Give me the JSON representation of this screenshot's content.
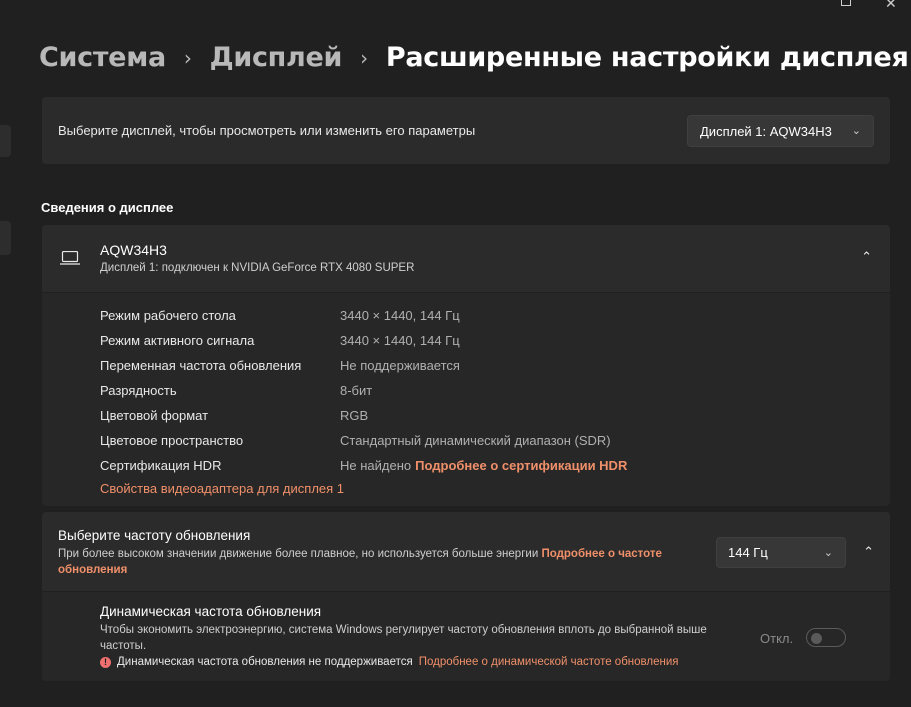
{
  "window": {
    "maximize_icon": "maximize-icon",
    "close_icon": "close-icon"
  },
  "breadcrumb": {
    "items": [
      "Система",
      "Дисплей"
    ],
    "current": "Расширенные настройки дисплея",
    "separator": "›"
  },
  "display_select": {
    "label": "Выберите дисплей, чтобы просмотреть или изменить его параметры",
    "selected": "Дисплей 1: AQW34H3"
  },
  "display_info": {
    "section_title": "Сведения о дисплее",
    "name": "AQW34H3",
    "subtitle": "Дисплей 1: подключен к NVIDIA GeForce RTX 4080 SUPER",
    "expanded": true,
    "rows": [
      {
        "key": "Режим рабочего стола",
        "value": "3440 × 1440, 144 Гц"
      },
      {
        "key": "Режим активного сигнала",
        "value": "3440 × 1440, 144 Гц"
      },
      {
        "key": "Переменная частота обновления",
        "value": "Не поддерживается"
      },
      {
        "key": "Разрядность",
        "value": "8-бит"
      },
      {
        "key": "Цветовой формат",
        "value": "RGB"
      },
      {
        "key": "Цветовое пространство",
        "value": "Стандартный динамический диапазон (SDR)"
      },
      {
        "key": "Сертификация HDR",
        "value": "Не найдено",
        "link": "Подробнее о сертификации HDR"
      }
    ],
    "adapter_link": "Свойства видеоадаптера для дисплея 1"
  },
  "refresh_rate": {
    "title": "Выберите частоту обновления",
    "description": "При более высоком значении движение более плавное, но используется больше энергии",
    "link": "Подробнее о частоте обновления",
    "selected": "144 Гц",
    "expanded": true
  },
  "dynamic_refresh": {
    "title": "Динамическая частота обновления",
    "description": "Чтобы экономить электроэнергию, система Windows регулирует частоту обновления вплоть до выбранной выше частоты.",
    "warning": "Динамическая частота обновления не поддерживается",
    "link": "Подробнее о динамической частоте обновления",
    "toggle_label": "Откл.",
    "toggle_on": false
  },
  "colors": {
    "accent_link": "#f0906a",
    "background": "#202020",
    "card": "#2b2b2b",
    "warning": "#f07070"
  }
}
